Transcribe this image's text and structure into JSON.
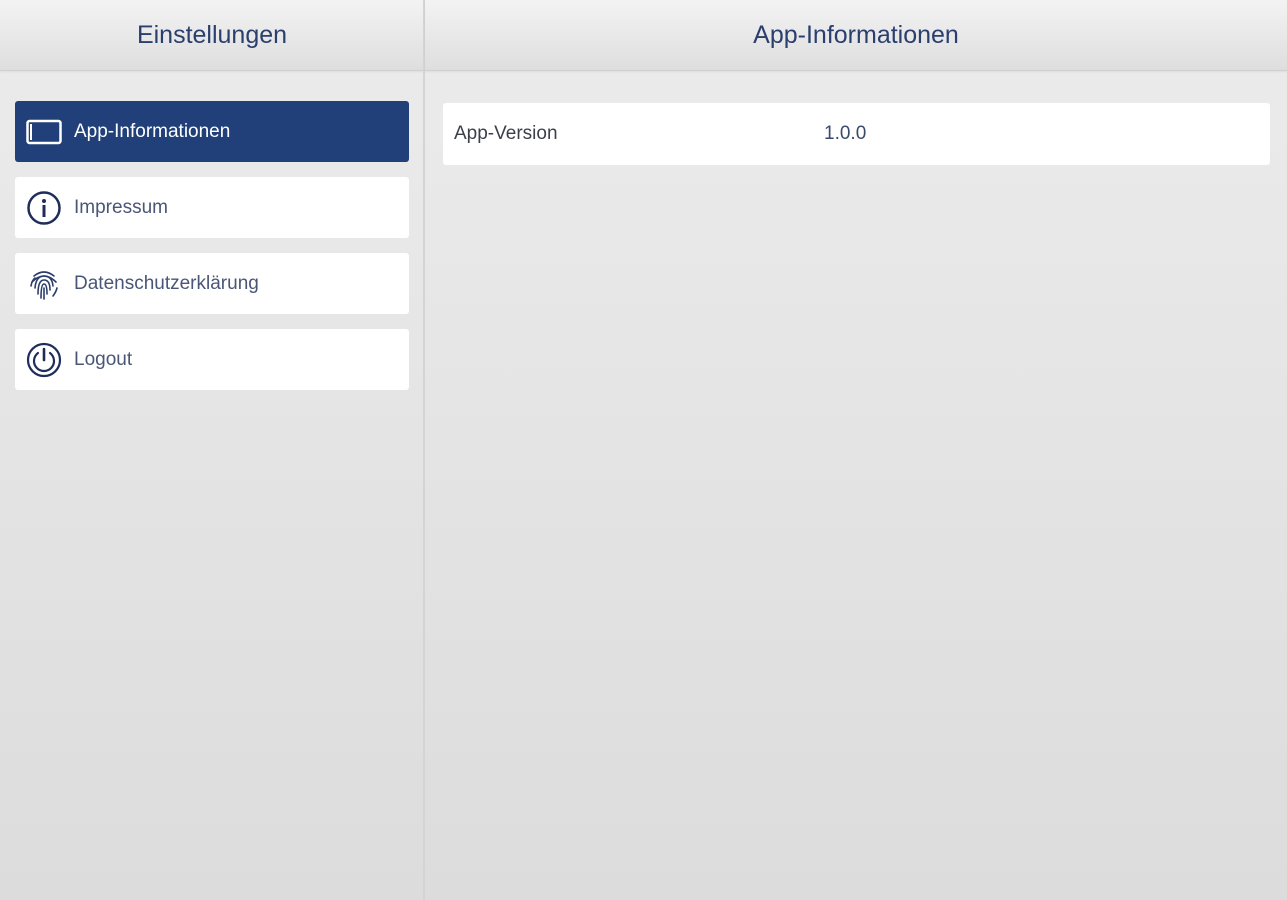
{
  "left_header": {
    "title": "Einstellungen"
  },
  "right_header": {
    "title": "App-Informationen"
  },
  "menu": {
    "items": [
      {
        "label": "App-Informationen",
        "icon": "tablet-icon",
        "active": true
      },
      {
        "label": "Impressum",
        "icon": "info-icon",
        "active": false
      },
      {
        "label": "Datenschutzerklärung",
        "icon": "fingerprint-icon",
        "active": false
      },
      {
        "label": "Logout",
        "icon": "power-icon",
        "active": false
      }
    ]
  },
  "info": {
    "rows": [
      {
        "label": "App-Version",
        "value": "1.0.0"
      }
    ]
  },
  "colors": {
    "accent": "#213f78",
    "header_text": "#2a3f6e"
  }
}
